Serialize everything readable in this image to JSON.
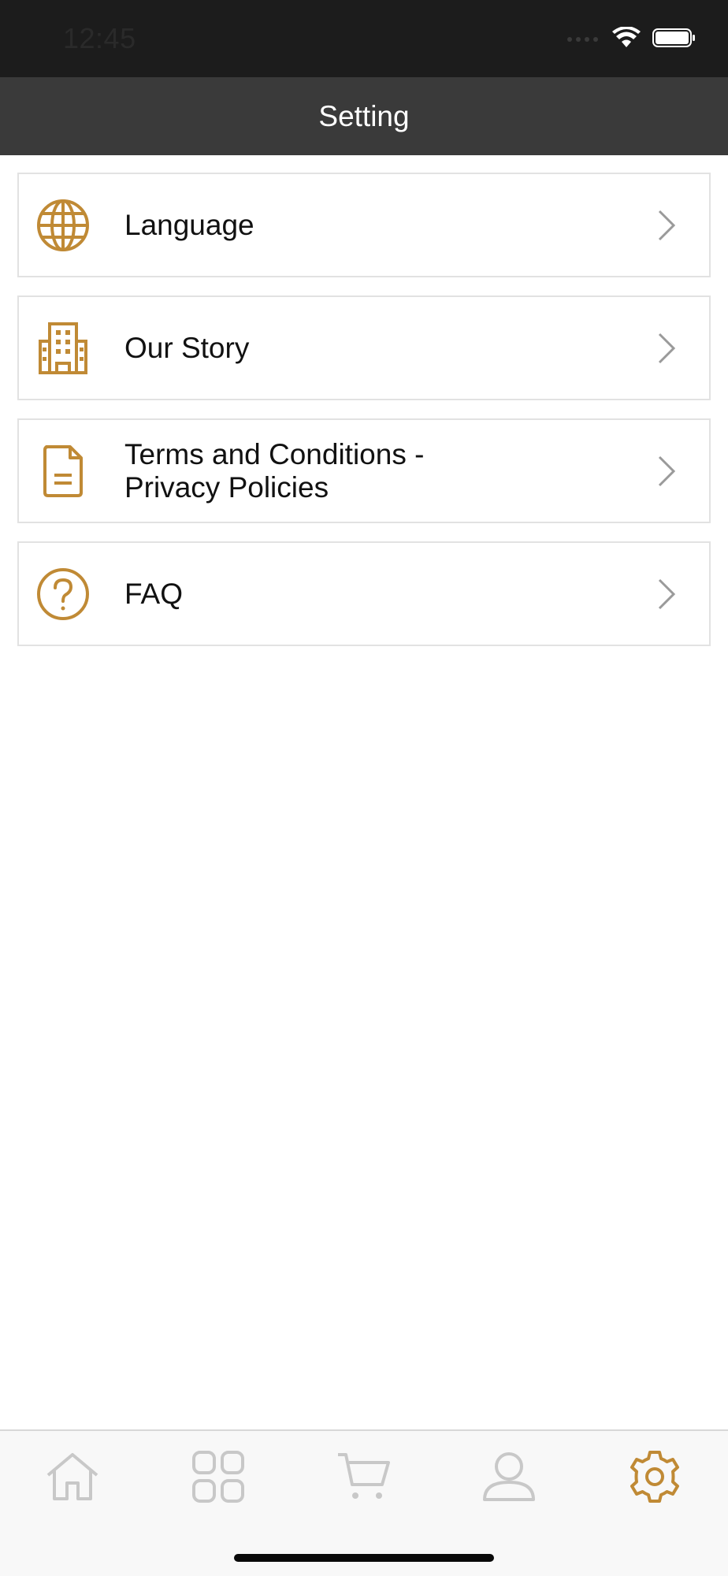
{
  "status_bar": {
    "time": "12:45"
  },
  "header": {
    "title": "Setting"
  },
  "menu": {
    "items": [
      {
        "label": "Language",
        "icon": "globe-icon"
      },
      {
        "label": "Our Story",
        "icon": "building-icon"
      },
      {
        "label": "Terms and Conditions -\nPrivacy Policies",
        "icon": "document-icon"
      },
      {
        "label": "FAQ",
        "icon": "question-circle-icon"
      }
    ]
  },
  "tab_bar": {
    "tabs": [
      {
        "icon": "home-icon",
        "active": false
      },
      {
        "icon": "grid-icon",
        "active": false
      },
      {
        "icon": "cart-icon",
        "active": false
      },
      {
        "icon": "user-icon",
        "active": false
      },
      {
        "icon": "gear-icon",
        "active": true
      }
    ]
  },
  "colors": {
    "accent": "#c08a35",
    "status_bar_bg": "#1c1c1c",
    "nav_bar_bg": "#3a3a3a",
    "inactive_icon": "#c8c8c8",
    "chevron": "#9a9a9a"
  }
}
